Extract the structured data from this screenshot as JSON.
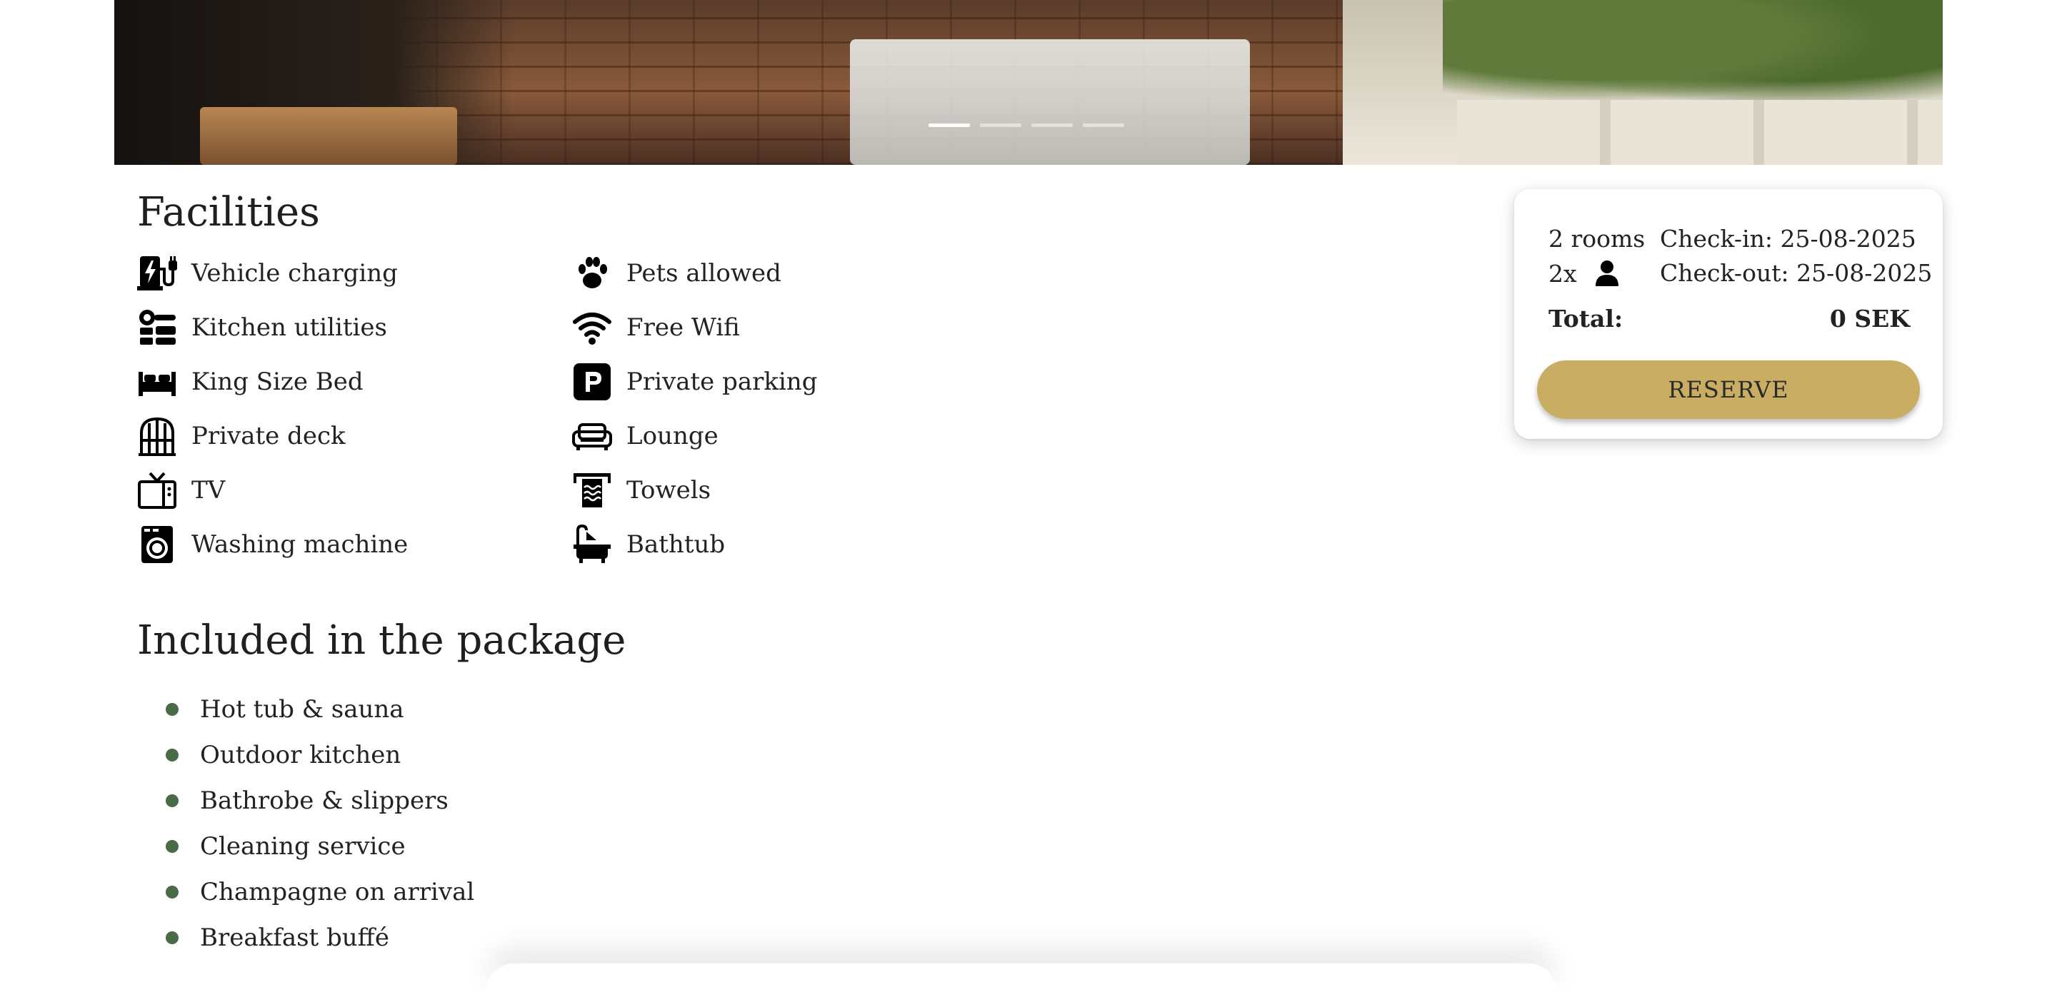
{
  "hero": {
    "slides_count": 4,
    "active_slide": 1
  },
  "facilities": {
    "title": "Facilities",
    "items": [
      {
        "icon": "ev-charging-icon",
        "label": "Vehicle charging"
      },
      {
        "icon": "paw-icon",
        "label": "Pets allowed"
      },
      {
        "icon": "kitchen-utilities-icon",
        "label": "Kitchen utilities"
      },
      {
        "icon": "wifi-icon",
        "label": "Free Wifi"
      },
      {
        "icon": "bed-icon",
        "label": "King Size Bed"
      },
      {
        "icon": "parking-icon",
        "label": "Private parking"
      },
      {
        "icon": "deck-icon",
        "label": "Private deck"
      },
      {
        "icon": "couch-icon",
        "label": "Lounge"
      },
      {
        "icon": "tv-icon",
        "label": "TV"
      },
      {
        "icon": "towel-icon",
        "label": "Towels"
      },
      {
        "icon": "washing-machine-icon",
        "label": "Washing machine"
      },
      {
        "icon": "bathtub-icon",
        "label": "Bathtub"
      }
    ]
  },
  "package": {
    "title": "Included in the package",
    "items": [
      "Hot tub & sauna",
      "Outdoor kitchen",
      "Bathrobe & slippers",
      "Cleaning service",
      "Champagne on arrival",
      "Breakfast buffé"
    ]
  },
  "booking": {
    "rooms": "2 rooms",
    "guests": "2x",
    "guest_icon": "person-icon",
    "checkin": "Check-in: 25-08-2025",
    "checkout": "Check-out: 25-08-2025",
    "total_label": "Total:",
    "total_value": "0 SEK",
    "reserve_label": "RESERVE"
  },
  "colors": {
    "accent_gold": "#c8ad62",
    "bullet_green": "#4a6b47",
    "text": "#1f1f1f"
  }
}
